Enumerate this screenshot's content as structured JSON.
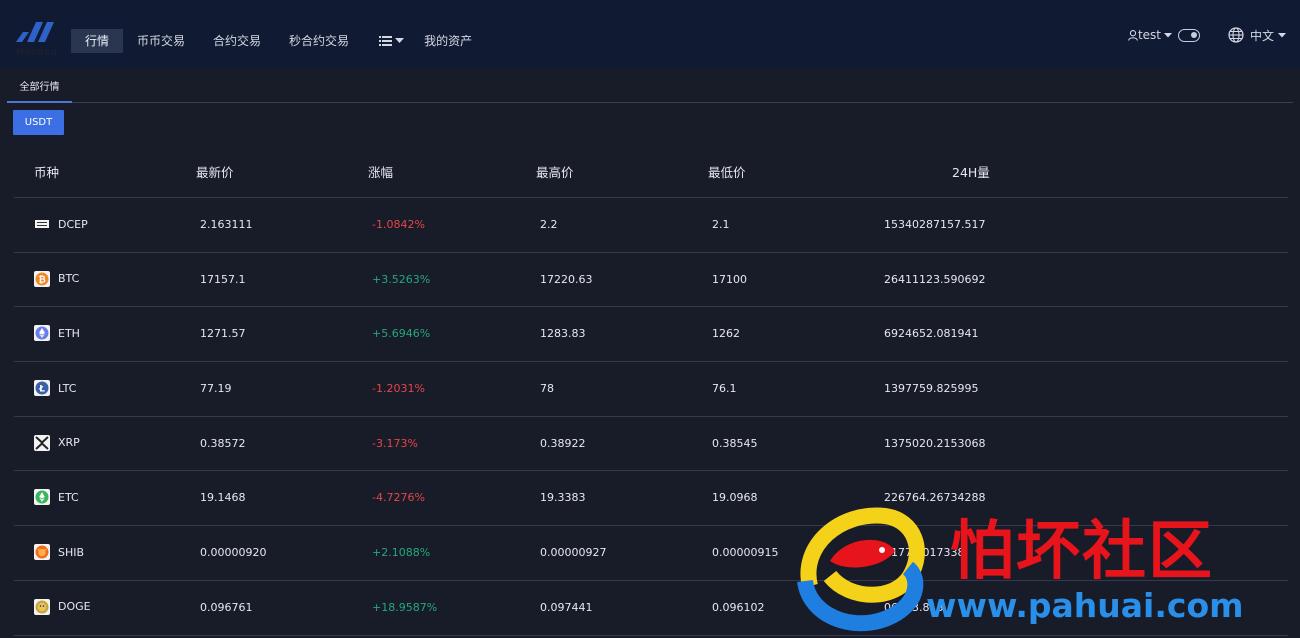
{
  "header": {
    "logo_text": "Nasdaq",
    "nav": [
      "行情",
      "币币交易",
      "合约交易",
      "秒合约交易"
    ],
    "nav_more_icon": "list-icon",
    "assets_label": "我的资产",
    "user_label": "test",
    "lang_label": "中文"
  },
  "tabs": {
    "all_markets": "全部行情",
    "quote_currency": "USDT"
  },
  "table": {
    "headers": [
      "币种",
      "最新价",
      "涨幅",
      "最高价",
      "最低价",
      "24H量"
    ],
    "rows": [
      {
        "coin": "DCEP",
        "icon": "dcep-icon",
        "price": "2.163111",
        "change": "-1.0842%",
        "high": "2.2",
        "low": "2.1",
        "volume": "15340287157.517"
      },
      {
        "coin": "BTC",
        "icon": "btc-icon",
        "price": "17157.1",
        "change": "+3.5263%",
        "high": "17220.63",
        "low": "17100",
        "volume": "26411123.590692"
      },
      {
        "coin": "ETH",
        "icon": "eth-icon",
        "price": "1271.57",
        "change": "+5.6946%",
        "high": "1283.83",
        "low": "1262",
        "volume": "6924652.081941"
      },
      {
        "coin": "LTC",
        "icon": "ltc-icon",
        "price": "77.19",
        "change": "-1.2031%",
        "high": "78",
        "low": "76.1",
        "volume": "1397759.825995"
      },
      {
        "coin": "XRP",
        "icon": "xrp-icon",
        "price": "0.38572",
        "change": "-3.173%",
        "high": "0.38922",
        "low": "0.38545",
        "volume": "1375020.2153068"
      },
      {
        "coin": "ETC",
        "icon": "etc-icon",
        "price": "19.1468",
        "change": "-4.7276%",
        "high": "19.3383",
        "low": "19.0968",
        "volume": "226764.26734288"
      },
      {
        "coin": "SHIB",
        "icon": "shib-icon",
        "price": "0.00000920",
        "change": "+2.1088%",
        "high": "0.00000927",
        "low": "0.00000915",
        "volume": "91773.017338"
      },
      {
        "coin": "DOGE",
        "icon": "doge-icon",
        "price": "0.096761",
        "change": "+18.9587%",
        "high": "0.097441",
        "low": "0.096102",
        "volume": "06873.813"
      }
    ]
  },
  "watermark": {
    "title": "怕坏社区",
    "url": "www.pahuai.com"
  },
  "colors": {
    "up": "#25a87c",
    "down": "#e4464a",
    "accent": "#3c6fe4",
    "nav_bg": "#111a33",
    "page_bg": "#181b28"
  }
}
